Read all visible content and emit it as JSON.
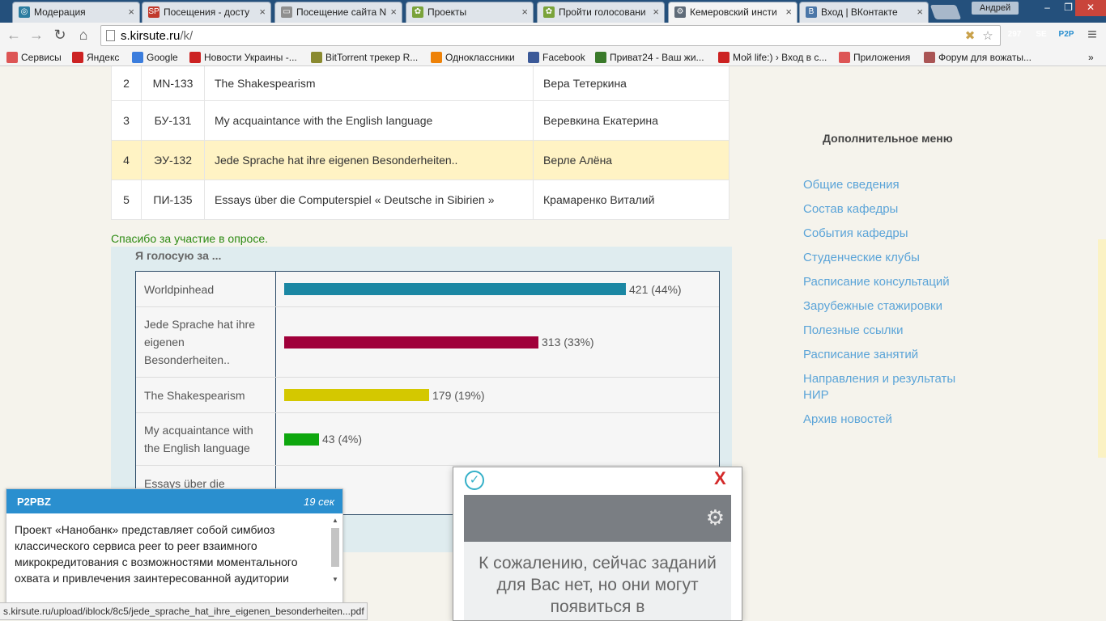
{
  "browser": {
    "tabs": [
      {
        "title": "Модерация",
        "icon_color": "#2b7ca0",
        "icon_glyph": "◎"
      },
      {
        "title": "Посещения - досту",
        "icon_color": "#c0392b",
        "icon_glyph": "SP"
      },
      {
        "title": "Посещение сайта N",
        "icon_color": "#8f8f8f",
        "icon_glyph": "▭"
      },
      {
        "title": "Проекты",
        "icon_color": "#7aa33a",
        "icon_glyph": "✿"
      },
      {
        "title": "Пройти голосовани",
        "icon_color": "#7aa33a",
        "icon_glyph": "✿"
      },
      {
        "title": "Кемеровский инсти",
        "icon_color": "#5f6b78",
        "icon_glyph": "⚙"
      },
      {
        "title": "Вход | ВКонтакте",
        "icon_color": "#4a76a8",
        "icon_glyph": "B"
      }
    ],
    "user_name": "Андрей",
    "window_buttons": {
      "minimize": "–",
      "restore": "❐",
      "close": "✕"
    },
    "url_host": "s.kirsute.ru",
    "url_path": "/k/",
    "extensions": [
      {
        "label": "297",
        "color": "#d33b2a"
      },
      {
        "label": "SE",
        "color": "#e0345a"
      },
      {
        "label": "P2P",
        "color": "#ffffff"
      }
    ],
    "bookmarks": [
      {
        "label": "Сервисы",
        "icon": "apps-icon",
        "color": "#d55"
      },
      {
        "label": "Яндекс",
        "icon": "yandex-icon",
        "color": "#c22"
      },
      {
        "label": "Google",
        "icon": "google-icon",
        "color": "#3b7ddd"
      },
      {
        "label": "Новости Украины -...",
        "icon": "news-icon",
        "color": "#c22"
      },
      {
        "label": "BitTorrent трекер R...",
        "icon": "torrent-icon",
        "color": "#8a8a30"
      },
      {
        "label": "Одноклассники",
        "icon": "ok-icon",
        "color": "#ee8208"
      },
      {
        "label": "Facebook",
        "icon": "facebook-icon",
        "color": "#3b5998"
      },
      {
        "label": "Приват24 - Ваш жи...",
        "icon": "privat-icon",
        "color": "#3a7a2a"
      },
      {
        "label": "Мой life:) › Вход в с...",
        "icon": "life-icon",
        "color": "#c22"
      },
      {
        "label": "Приложения",
        "icon": "apps-icon",
        "color": "#d55"
      },
      {
        "label": "Форум для вожаты...",
        "icon": "forum-icon",
        "color": "#a55"
      }
    ]
  },
  "projects": [
    {
      "num": "2",
      "group": "МN-133",
      "title": "The Shakespearism",
      "author": "Вера Тетеркина"
    },
    {
      "num": "3",
      "group": "БУ-131",
      "title": "My acquaintance with the English language",
      "author": "Веревкина Екатерина"
    },
    {
      "num": "4",
      "group": "ЭУ-132",
      "title": "Jede Sprache hat ihre eigenen Besonderheiten..",
      "author": "Верле Алёна"
    },
    {
      "num": "5",
      "group": "ПИ-135",
      "title": "Essays über die Computerspiel « Deutsche in Sibirien »",
      "author": "Крамаренко Виталий"
    }
  ],
  "thanks_message": "Спасибо за участие в опросе.",
  "poll": {
    "heading": "Я голосую за ...",
    "options": [
      {
        "label": "Worldpinhead",
        "votes": 421,
        "count_text": "421 (44%)",
        "color": "#1b87a3"
      },
      {
        "label": "Jede Sprache hat ihre eigenen Besonderheiten..",
        "votes": 313,
        "count_text": "313 (33%)",
        "color": "#a0003a"
      },
      {
        "label": "The Shakespearism",
        "votes": 179,
        "count_text": "179 (19%)",
        "color": "#d4c800"
      },
      {
        "label": "My acquaintance with the English language",
        "votes": 43,
        "count_text": "43 (4%)",
        "color": "#0ea70e"
      },
      {
        "label": "Essays über die",
        "votes": 0,
        "count_text": "",
        "color": "#1b87a3"
      }
    ]
  },
  "side_menu": {
    "title": "Дополнительное меню",
    "items": [
      "Общие сведения",
      "Состав кафедры",
      "События кафедры",
      "Студенческие клубы",
      "Расписание консультаций",
      "Зарубежные стажировки",
      "Полезные ссылки",
      "Расписание занятий",
      "Направления и результаты НИР",
      "Архив новостей"
    ]
  },
  "notification": {
    "title": "P2PBZ",
    "time": "19 сек",
    "text": "Проект «Нанобанк» представляет собой симбиоз классического сервиса peer to peer взаимного микрокредитования с возможностями моментального охвата и привлечения заинтересованной аудитории"
  },
  "task_popup": {
    "close": "X",
    "message": "К сожалению, сейчас заданий для Вас нет, но они могут появиться в"
  },
  "status_url": "s.kirsute.ru/upload/iblock/8c5/jede_sprache_hat_ihre_eigenen_besonderheiten...pdf"
}
